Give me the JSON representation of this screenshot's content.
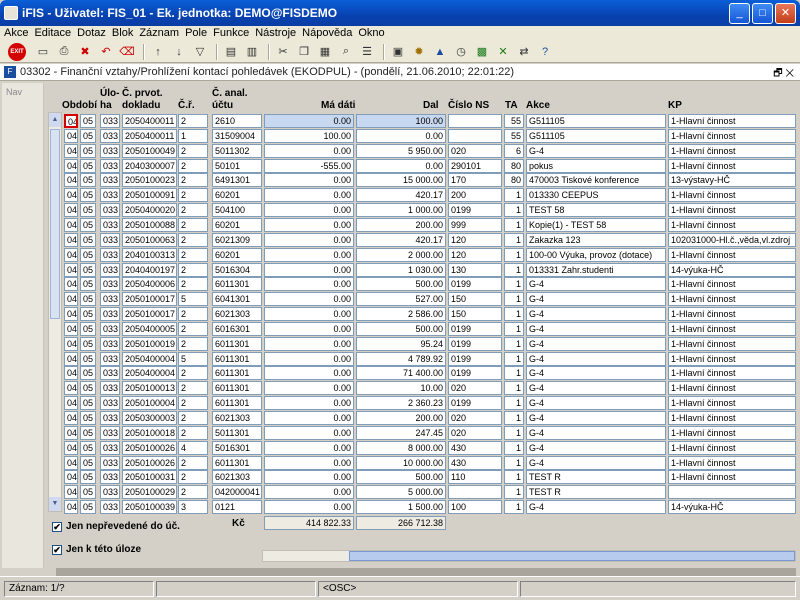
{
  "window": {
    "title": "iFIS - Uživatel: FIS_01 - Ek. jednotka: DEMO@FISDEMO",
    "min": "_",
    "max": "□",
    "close": "✕"
  },
  "menu": [
    "Akce",
    "Editace",
    "Dotaz",
    "Blok",
    "Záznam",
    "Pole",
    "Funkce",
    "Nástroje",
    "Nápověda",
    "Okno"
  ],
  "toolbar": {
    "exit": "EXIT",
    "icons": [
      "save-icon",
      "print-icon",
      "delete-icon",
      "undo-icon",
      "clear-icon",
      "sort-asc-icon",
      "sort-desc-icon",
      "filter-icon",
      "printer-icon",
      "report-icon",
      "cut-icon",
      "copy-icon",
      "paste-icon",
      "find-icon",
      "list-icon",
      "calculator-icon",
      "settings-icon",
      "chart-icon",
      "clock-icon",
      "calendar-icon",
      "excel-icon",
      "export-icon",
      "help-icon"
    ]
  },
  "form": {
    "icon": "F",
    "title": "03302 - Finanční vztahy/Prohlížení kontací pohledávek (EKODPUL) - (pondělí, 21.06.2010; 22:01:22)",
    "restore": "🗗",
    "close": "✕"
  },
  "nav": {
    "label": "Nav"
  },
  "headers": {
    "obdobi": "Období",
    "ulo1": "Úlo-",
    "ulo2": "ha",
    "cprot1": "Č. prvot.",
    "cprot2": "dokladu",
    "cr": "Č.ř.",
    "canal1": "Č. anal.",
    "canal2": "účtu",
    "madati": "Má dáti",
    "dal": "Dal",
    "cislons": "Číslo NS",
    "ta": "TA",
    "akce": "Akce",
    "kp": "KP"
  },
  "rows": [
    [
      "04",
      "05",
      "033",
      "2050400011",
      "2",
      "2610",
      "0.00",
      "100.00",
      "",
      "55",
      "G511105",
      "1-Hlavní činnost"
    ],
    [
      "04",
      "05",
      "033",
      "2050400011",
      "1",
      "31509004",
      "100.00",
      "0.00",
      "",
      "55",
      "G511105",
      "1-Hlavní činnost"
    ],
    [
      "04",
      "05",
      "033",
      "2050100049",
      "2",
      "5011302",
      "0.00",
      "5 950.00",
      "020",
      "6",
      "G-4",
      "1-Hlavní činnost"
    ],
    [
      "04",
      "05",
      "033",
      "2040300007",
      "2",
      "50101",
      "-555.00",
      "0.00",
      "290101",
      "80",
      "pokus",
      "1-Hlavní činnost"
    ],
    [
      "04",
      "05",
      "033",
      "2050100023",
      "2",
      "6491301",
      "0.00",
      "15 000.00",
      "170",
      "80",
      "470003 Tiskové konference",
      "13-výstavy-HČ"
    ],
    [
      "04",
      "05",
      "033",
      "2050100091",
      "2",
      "60201",
      "0.00",
      "420.17",
      "200",
      "1",
      "013330 CEEPUS",
      "1-Hlavní činnost"
    ],
    [
      "04",
      "05",
      "033",
      "2050400020",
      "2",
      "504100",
      "0.00",
      "1 000.00",
      "0199",
      "1",
      "TEST 58",
      "1-Hlavní činnost"
    ],
    [
      "04",
      "05",
      "033",
      "2050100088",
      "2",
      "60201",
      "0.00",
      "200.00",
      "999",
      "1",
      "Kopie(1) - TEST 58",
      "1-Hlavní činnost"
    ],
    [
      "04",
      "05",
      "033",
      "2050100063",
      "2",
      "6021309",
      "0.00",
      "420.17",
      "120",
      "1",
      "Zakazka 123",
      "102031000-Hl.č.,věda,vl.zdroj"
    ],
    [
      "04",
      "05",
      "033",
      "2040100313",
      "2",
      "60201",
      "0.00",
      "2 000.00",
      "120",
      "1",
      "100-00 Výuka, provoz (dotace)",
      "1-Hlavní činnost"
    ],
    [
      "04",
      "05",
      "033",
      "2040400197",
      "2",
      "5016304",
      "0.00",
      "1 030.00",
      "130",
      "1",
      "013331 Zahr.studenti",
      "14-výuka-HČ"
    ],
    [
      "04",
      "05",
      "033",
      "2050400006",
      "2",
      "6011301",
      "0.00",
      "500.00",
      "0199",
      "1",
      "G-4",
      "1-Hlavní činnost"
    ],
    [
      "04",
      "05",
      "033",
      "2050100017",
      "5",
      "6041301",
      "0.00",
      "527.00",
      "150",
      "1",
      "G-4",
      "1-Hlavní činnost"
    ],
    [
      "04",
      "05",
      "033",
      "2050100017",
      "2",
      "6021303",
      "0.00",
      "2 586.00",
      "150",
      "1",
      "G-4",
      "1-Hlavní činnost"
    ],
    [
      "04",
      "05",
      "033",
      "2050400005",
      "2",
      "6016301",
      "0.00",
      "500.00",
      "0199",
      "1",
      "G-4",
      "1-Hlavní činnost"
    ],
    [
      "04",
      "05",
      "033",
      "2050100019",
      "2",
      "6011301",
      "0.00",
      "95.24",
      "0199",
      "1",
      "G-4",
      "1-Hlavní činnost"
    ],
    [
      "04",
      "05",
      "033",
      "2050400004",
      "5",
      "6011301",
      "0.00",
      "4 789.92",
      "0199",
      "1",
      "G-4",
      "1-Hlavní činnost"
    ],
    [
      "04",
      "05",
      "033",
      "2050400004",
      "2",
      "6011301",
      "0.00",
      "71 400.00",
      "0199",
      "1",
      "G-4",
      "1-Hlavní činnost"
    ],
    [
      "04",
      "05",
      "033",
      "2050100013",
      "2",
      "6011301",
      "0.00",
      "10.00",
      "020",
      "1",
      "G-4",
      "1-Hlavní činnost"
    ],
    [
      "04",
      "05",
      "033",
      "2050100004",
      "2",
      "6011301",
      "0.00",
      "2 360.23",
      "0199",
      "1",
      "G-4",
      "1-Hlavní činnost"
    ],
    [
      "04",
      "05",
      "033",
      "2050300003",
      "2",
      "6021303",
      "0.00",
      "200.00",
      "020",
      "1",
      "G-4",
      "1-Hlavní činnost"
    ],
    [
      "04",
      "05",
      "033",
      "2050100018",
      "2",
      "5011301",
      "0.00",
      "247.45",
      "020",
      "1",
      "G-4",
      "1-Hlavní činnost"
    ],
    [
      "04",
      "05",
      "033",
      "2050100026",
      "4",
      "5016301",
      "0.00",
      "8 000.00",
      "430",
      "1",
      "G-4",
      "1-Hlavní činnost"
    ],
    [
      "04",
      "05",
      "033",
      "2050100026",
      "2",
      "6011301",
      "0.00",
      "10 000.00",
      "430",
      "1",
      "G-4",
      "1-Hlavní činnost"
    ],
    [
      "04",
      "05",
      "033",
      "2050100031",
      "2",
      "6021303",
      "0.00",
      "500.00",
      "110",
      "1",
      "TEST R",
      "1-Hlavní činnost"
    ],
    [
      "04",
      "05",
      "033",
      "2050100029",
      "2",
      "042000041",
      "0.00",
      "5 000.00",
      "",
      "1",
      "TEST R",
      ""
    ],
    [
      "04",
      "05",
      "033",
      "2050100039",
      "3",
      "0121",
      "0.00",
      "1 500.00",
      "100",
      "1",
      "G-4",
      "14-výuka-HČ"
    ]
  ],
  "totals": {
    "label": "Kč",
    "madati": "414 822.33",
    "dal": "266 712.38"
  },
  "checks": [
    {
      "label": "Jen nepřevedené do úč.",
      "checked": "✔"
    },
    {
      "label": "Jen k této úloze",
      "checked": "✔"
    }
  ],
  "status": {
    "record": "Záznam: 1/?",
    "osc": "<OSC>"
  }
}
